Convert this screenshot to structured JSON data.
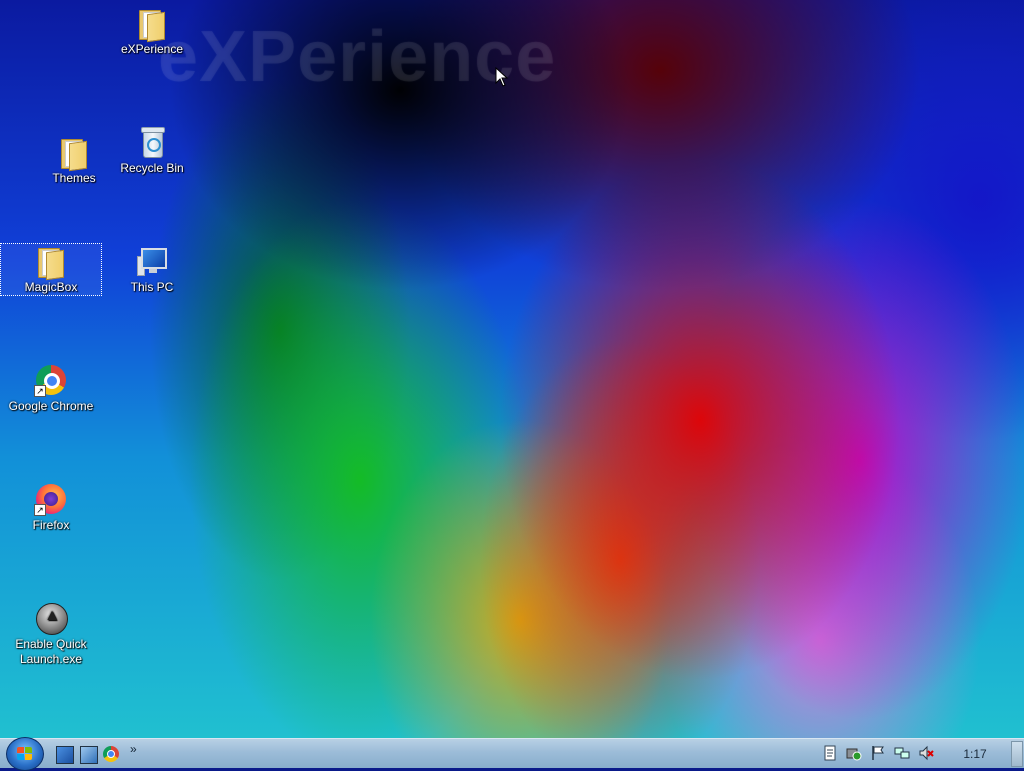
{
  "wallpaper": {
    "watermark": "eXPerience"
  },
  "desktop_icons": [
    {
      "label": "eXPerience",
      "icon": "folder-icon"
    },
    {
      "label": "Themes",
      "icon": "folder-icon"
    },
    {
      "label": "Recycle Bin",
      "icon": "recycle-bin-icon"
    },
    {
      "label": "MagicBox",
      "icon": "folder-icon",
      "selected": true
    },
    {
      "label": "This PC",
      "icon": "computer-icon"
    },
    {
      "label": "Google Chrome",
      "icon": "chrome-icon",
      "shortcut": true
    },
    {
      "label": "Firefox",
      "icon": "firefox-icon",
      "shortcut": true
    },
    {
      "label": "Enable Quick Launch.exe",
      "icon": "quick-launch-app-icon"
    }
  ],
  "taskbar": {
    "start_button": "windows-start-orb-icon",
    "quick_launch": [
      "show-desktop-icon",
      "switch-windows-icon",
      "chrome-icon"
    ],
    "overflow_glyph": "»",
    "tray_icons": [
      "document-icon",
      "security-shield-icon",
      "action-center-flag-icon",
      "network-icon",
      "volume-muted-icon"
    ],
    "clock": "1:17"
  },
  "colors": {
    "taskbar_top": "#b8d0e4",
    "taskbar_bottom": "#88aecc",
    "start_orb": "#2a70c8"
  }
}
